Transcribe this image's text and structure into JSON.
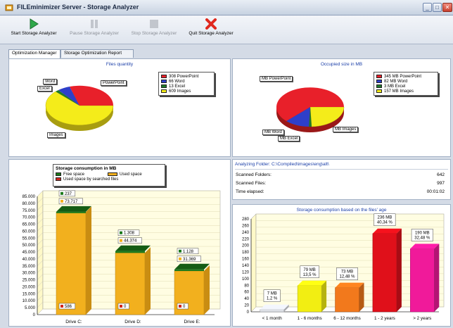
{
  "window": {
    "title": "FILEminimizer Server - Storage Analyzer"
  },
  "toolbar": {
    "start": "Start Storage Analyzer",
    "pause": "Pause Storage Analyzer",
    "stop": "Stop Storage Analyzer",
    "quit": "Quit Storage Analyzer"
  },
  "tabs": [
    "Optimization Manager",
    "Storage Optimization Report"
  ],
  "files_quantity": {
    "title": "Files quantity",
    "legend": [
      "308 PowerPoint",
      "66 Word",
      "13 Excel",
      "609 Images"
    ],
    "labels": [
      "Word",
      "Excel",
      "PowerPoint",
      "Images"
    ]
  },
  "occupied_size": {
    "title": "Occupied size in MB",
    "legend": [
      "345 MB PowerPoint",
      "82 MB Word",
      "3 MB Excel",
      "157 MB Images"
    ],
    "labels": [
      "MB PowerPoint",
      "MB Word",
      "MB Excel",
      "MB Images"
    ]
  },
  "storage_consumption": {
    "title": "Storage consumption in MB",
    "legend": [
      "Free space",
      "Used space",
      "Used space by searched files"
    ]
  },
  "analyzing": {
    "folder_label": "Analyzing Folder:",
    "folder": "C:\\Compiled\\images\\eng\\alt\\",
    "rows": [
      {
        "label": "Scanned Folders:",
        "value": "642"
      },
      {
        "label": "Scanned Files:",
        "value": "997"
      },
      {
        "label": "Time elapsed:",
        "value": "00:01:02"
      }
    ]
  },
  "age_chart": {
    "title": "Storage consumption based on the files' age"
  },
  "colors": {
    "powerpoint": "#e8202a",
    "word": "#2e3fc9",
    "excel": "#1f7a2a",
    "images": "#f4ec1a",
    "free": "#1c7a1c",
    "used": "#f2b01e",
    "searched": "#d0261e"
  },
  "chart_data": [
    {
      "type": "pie",
      "title": "Files quantity",
      "labels": [
        "PowerPoint",
        "Word",
        "Excel",
        "Images"
      ],
      "values": [
        308,
        66,
        13,
        609
      ]
    },
    {
      "type": "pie",
      "title": "Occupied size in MB",
      "labels": [
        "PowerPoint",
        "Word",
        "Excel",
        "Images"
      ],
      "values": [
        345,
        82,
        3,
        157
      ]
    },
    {
      "type": "bar",
      "title": "Storage consumption in MB",
      "categories": [
        "Drive C:",
        "Drive D:",
        "Drive E:"
      ],
      "series": [
        {
          "name": "Free space",
          "values": [
            237,
            1308,
            1128
          ]
        },
        {
          "name": "Used space",
          "values": [
            73717,
            44374,
            31369
          ]
        },
        {
          "name": "Used space by searched files",
          "values": [
            586,
            0,
            0
          ]
        }
      ],
      "ylim": [
        0,
        85000
      ],
      "yticks": [
        "0",
        "5.000",
        "10.000",
        "15.000",
        "20.000",
        "25.000",
        "30.000",
        "35.000",
        "40.000",
        "45.000",
        "50.000",
        "55.000",
        "60.000",
        "65.000",
        "70.000",
        "75.000",
        "80.000",
        "85.000"
      ],
      "value_labels": [
        {
          "free": "237",
          "used": "73.717",
          "searched": "586"
        },
        {
          "free": "1.308",
          "used": "44.374",
          "searched": "0"
        },
        {
          "free": "1.128",
          "used": "31.369",
          "searched": "0"
        }
      ]
    },
    {
      "type": "bar",
      "title": "Storage consumption based on the files' age",
      "categories": [
        "< 1 month",
        "1 - 6 months",
        "6 - 12 months",
        "1 - 2 years",
        "> 2 years"
      ],
      "values": [
        7,
        79,
        73,
        236,
        190
      ],
      "colors": [
        "#dde0e6",
        "#f2ee12",
        "#f2791c",
        "#e0101a",
        "#f01a9a"
      ],
      "labels": [
        "7 MB\n1,2 %",
        "79 MB\n13,5 %",
        "73 MB\n12,48 %",
        "236 MB\n40,34 %",
        "190 MB\n32,48 %"
      ],
      "ylim": [
        0,
        280
      ],
      "yticks": [
        "0",
        "20",
        "40",
        "60",
        "80",
        "100",
        "120",
        "140",
        "160",
        "180",
        "200",
        "220",
        "240",
        "260",
        "280"
      ]
    }
  ]
}
